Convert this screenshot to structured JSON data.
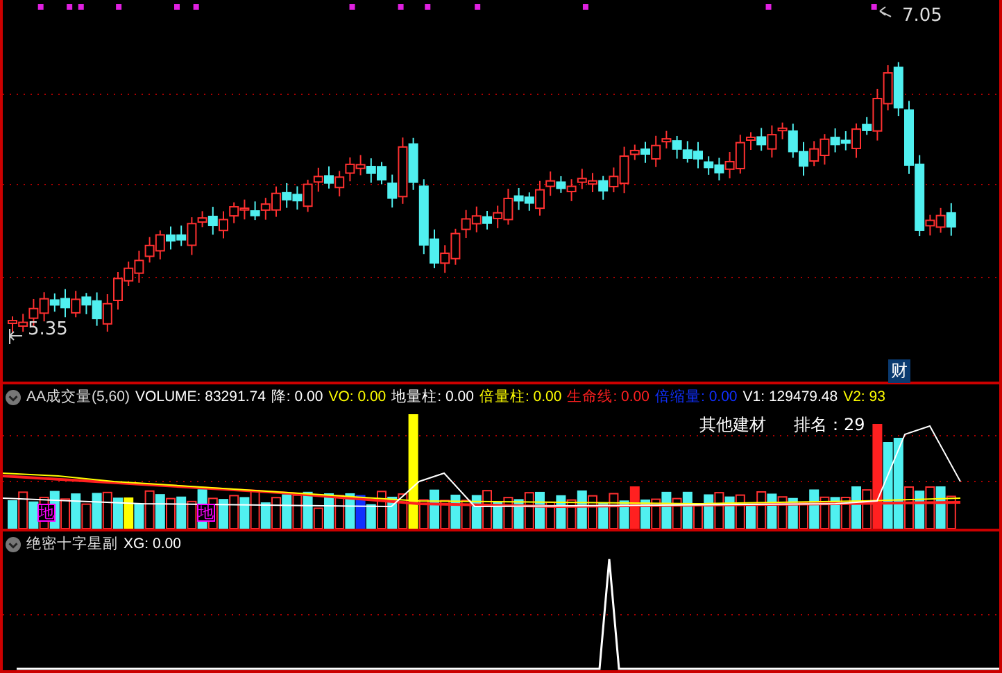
{
  "price_chart": {
    "high_label": "7.05",
    "low_label": "5.35",
    "badge": "财"
  },
  "volume_panel": {
    "title": "AA成交量(5,60)",
    "legend": [
      {
        "text": "VOLUME: 83291.74",
        "color": "#ffffff"
      },
      {
        "text": "降: 0.00",
        "color": "#ffffff"
      },
      {
        "text": "VO: 0.00",
        "color": "#ffff00"
      },
      {
        "text": "地量柱: 0.00",
        "color": "#ffffff"
      },
      {
        "text": "倍量柱: 0.00",
        "color": "#ffff00"
      },
      {
        "text": "生命线: 0.00",
        "color": "#ff2020"
      },
      {
        "text": "倍缩量: 0.00",
        "color": "#1030ff"
      },
      {
        "text": "V1: 129479.48",
        "color": "#ffffff"
      },
      {
        "text": "V2: 93",
        "color": "#ffff00"
      }
    ],
    "sector": "其他建材",
    "rank": "排名：29",
    "markers": [
      "地",
      "地"
    ]
  },
  "signal_panel": {
    "title": "绝密十字星副",
    "legend": [
      {
        "text": "XG: 0.00",
        "color": "#ffffff"
      }
    ]
  }
}
